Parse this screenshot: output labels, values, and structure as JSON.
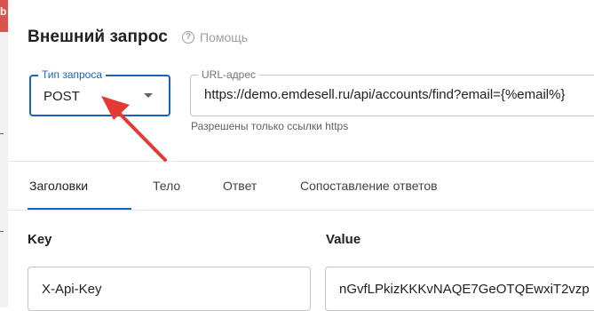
{
  "header": {
    "title": "Внешний запрос",
    "help_label": "Помощь",
    "help_icon": "question-circle-icon"
  },
  "request_type": {
    "label": "Тип запроса",
    "value": "POST",
    "arrow_icon": "caret-down-icon"
  },
  "url": {
    "label": "URL-адрес",
    "value": "https://demo.emdesell.ru/api/accounts/find?email={%email%}",
    "helper": "Разрешены только ссылки https"
  },
  "tabs": [
    {
      "label": "Заголовки",
      "active": true
    },
    {
      "label": "Тело",
      "active": false
    },
    {
      "label": "Ответ",
      "active": false
    },
    {
      "label": "Сопоставление ответов",
      "active": false
    }
  ],
  "headers_table": {
    "key_label": "Key",
    "value_label": "Value",
    "rows": [
      {
        "key": "X-Api-Key",
        "value": "nGvfLPkizKKKvNAQE7GeOTQEwxiT2vzp"
      }
    ]
  },
  "left_strip": {
    "badge_text": "b"
  },
  "colors": {
    "accent": "#1565c0",
    "annotation_arrow": "#e53935"
  }
}
